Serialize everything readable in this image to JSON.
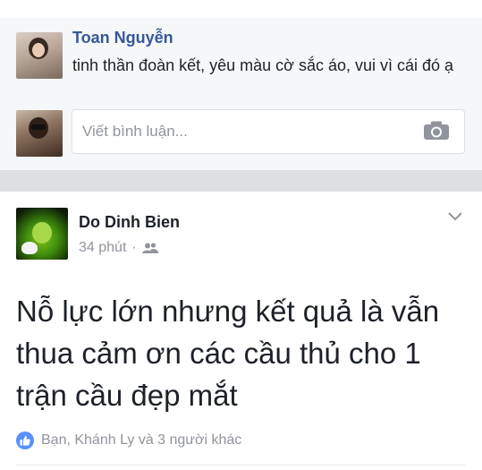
{
  "comment": {
    "author": "Toan Nguyễn",
    "text": "tinh thần đoàn kết, yêu màu cờ sắc áo, vui vì cái đó ạ"
  },
  "comment_input": {
    "placeholder": "Viết bình luận...",
    "camera_icon": "camera-icon"
  },
  "post": {
    "author": "Do Dinh Bien",
    "time": "34 phút",
    "separator": "·",
    "privacy_icon": "friends-icon",
    "menu_icon": "chevron-down-icon",
    "text": "Nỗ lực lớn nhưng kết quả là vẫn thua cảm ơn các cầu thủ cho 1 trận cầu đẹp mắt",
    "reactions_text": "Bạn, Khánh Ly và 3 người khác",
    "reaction_icon": "like-icon"
  },
  "colors": {
    "link_blue": "#365899",
    "like_blue": "#5890ff",
    "gray_text": "#90949c",
    "section_bg": "#f6f7f9",
    "divider": "#dddfe2"
  }
}
